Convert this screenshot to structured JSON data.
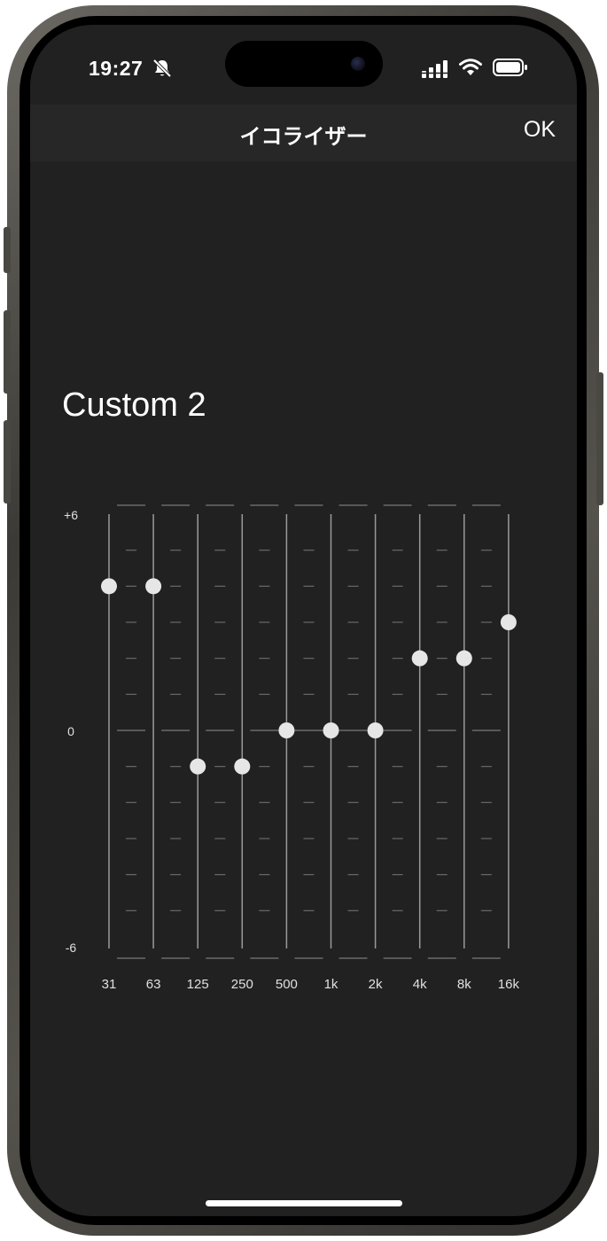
{
  "status_bar": {
    "time": "19:27",
    "icons": [
      "bell-off-icon",
      "cellular-signal-icon",
      "wifi-icon",
      "battery-icon"
    ]
  },
  "nav": {
    "title": "イコライザー",
    "ok_label": "OK"
  },
  "preset": {
    "name": "Custom 2"
  },
  "equalizer": {
    "y_labels": {
      "max": "+6",
      "zero": "0",
      "min": "-6"
    },
    "range_db": [
      -6,
      6
    ],
    "bands": [
      {
        "label": "31",
        "gain_db": 4
      },
      {
        "label": "63",
        "gain_db": 4
      },
      {
        "label": "125",
        "gain_db": -1
      },
      {
        "label": "250",
        "gain_db": -1
      },
      {
        "label": "500",
        "gain_db": 0
      },
      {
        "label": "1k",
        "gain_db": 0
      },
      {
        "label": "2k",
        "gain_db": 0
      },
      {
        "label": "4k",
        "gain_db": 2
      },
      {
        "label": "8k",
        "gain_db": 2
      },
      {
        "label": "16k",
        "gain_db": 3
      }
    ]
  },
  "colors": {
    "screen_background": "#212121",
    "nav_background": "#272727",
    "text": "#ffffff",
    "track": "#9a9a9a",
    "tick": "#6a6a6a",
    "knob": "#e6e6e6"
  }
}
